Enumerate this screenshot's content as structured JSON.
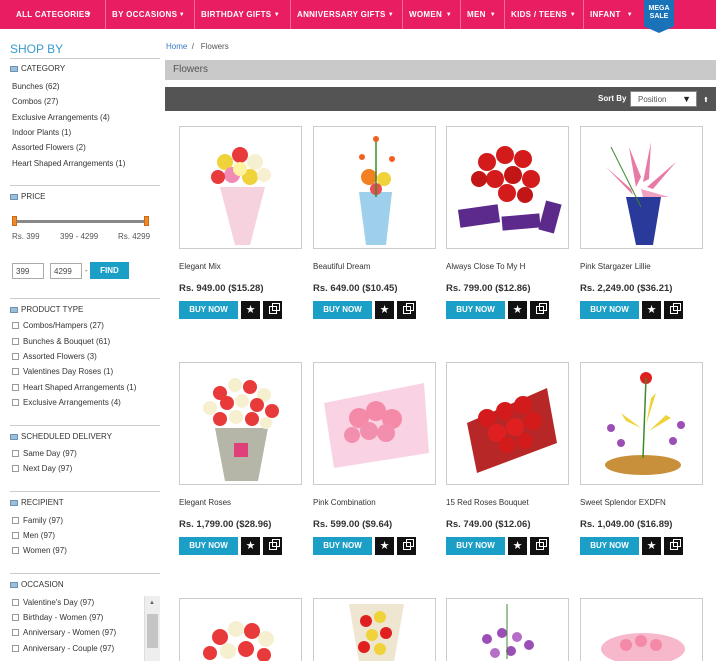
{
  "nav": {
    "items": [
      "ALL CATEGORIES",
      "BY OCCASIONS",
      "BIRTHDAY GIFTS",
      "ANNIVERSARY GIFTS",
      "WOMEN",
      "MEN",
      "KIDS / TEENS",
      "INFANT"
    ],
    "mega_line1": "MEGA",
    "mega_line2": "SALE"
  },
  "sidebar": {
    "title": "SHOP BY",
    "category": {
      "heading": "CATEGORY",
      "items": [
        "Bunches (62)",
        "Combos (27)",
        "Exclusive Arrangements (4)",
        "Indoor Plants (1)",
        "Assorted Flowers (2)",
        "Heart Shaped Arrangements (1)"
      ]
    },
    "price": {
      "heading": "PRICE",
      "min_label": "Rs. 399",
      "range_label": "399 - 4299",
      "max_label": "Rs. 4299",
      "min_value": "399",
      "max_value": "4299",
      "find_label": "FIND"
    },
    "product_type": {
      "heading": "PRODUCT TYPE",
      "items": [
        "Combos/Hampers (27)",
        "Bunches & Bouquet (61)",
        "Assorted Flowers (3)",
        "Valentines Day Roses (1)",
        "Heart Shaped Arrangements (1)",
        "Exclusive Arrangements (4)"
      ]
    },
    "delivery": {
      "heading": "SCHEDULED DELIVERY",
      "items": [
        "Same Day (97)",
        "Next Day (97)"
      ]
    },
    "recipient": {
      "heading": "RECIPIENT",
      "items": [
        "Family (97)",
        "Men (97)",
        "Women (97)"
      ]
    },
    "occasion": {
      "heading": "OCCASION",
      "items": [
        "Valentine's Day (97)",
        "Birthday - Women (97)",
        "Anniversary - Women (97)",
        "Anniversary - Couple (97)"
      ]
    }
  },
  "breadcrumb": {
    "home": "Home",
    "sep": "/",
    "current": "Flowers"
  },
  "page_title": "Flowers",
  "sort": {
    "label": "Sort By",
    "value": "Position"
  },
  "buttons": {
    "buy_now": "BUY NOW"
  },
  "products": [
    {
      "name": "Elegant Mix",
      "price": "Rs. 949.00 ($15.28)"
    },
    {
      "name": "Beautiful Dream",
      "price": "Rs. 649.00 ($10.45)"
    },
    {
      "name": "Always Close To My H",
      "price": "Rs. 799.00 ($12.86)"
    },
    {
      "name": "Pink Stargazer Lillie",
      "price": "Rs. 2,249.00 ($36.21)"
    },
    {
      "name": "Elegant Roses",
      "price": "Rs. 1,799.00 ($28.96)"
    },
    {
      "name": "Pink Combination",
      "price": "Rs. 599.00 ($9.64)"
    },
    {
      "name": "15 Red Roses Bouquet",
      "price": "Rs. 749.00 ($12.06)"
    },
    {
      "name": "Sweet Splendor EXDFN",
      "price": "Rs. 1,049.00 ($16.89)"
    }
  ],
  "colors": {
    "brand": "#e81d62",
    "accent": "#1b9fc6",
    "link": "#3a9bd0"
  }
}
